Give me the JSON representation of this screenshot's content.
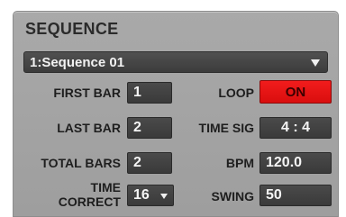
{
  "panel": {
    "title": "SEQUENCE",
    "sequence_select": {
      "value": "1:Sequence 01"
    }
  },
  "fields": {
    "first_bar": {
      "label": "FIRST BAR",
      "value": "1"
    },
    "last_bar": {
      "label": "LAST BAR",
      "value": "2"
    },
    "total_bars": {
      "label": "TOTAL BARS",
      "value": "2"
    },
    "time_correct": {
      "label_line1": "TIME",
      "label_line2": "CORRECT",
      "value": "16"
    },
    "loop": {
      "label": "LOOP",
      "value": "ON"
    },
    "time_sig": {
      "label": "TIME SIG",
      "value": "4 : 4"
    },
    "bpm": {
      "label": "BPM",
      "value": "120.0"
    },
    "swing": {
      "label": "SWING",
      "value": "50"
    }
  },
  "colors": {
    "panel_bg": "#a3a3a3",
    "field_bg": "#444444",
    "loop_on": "#e51414"
  }
}
